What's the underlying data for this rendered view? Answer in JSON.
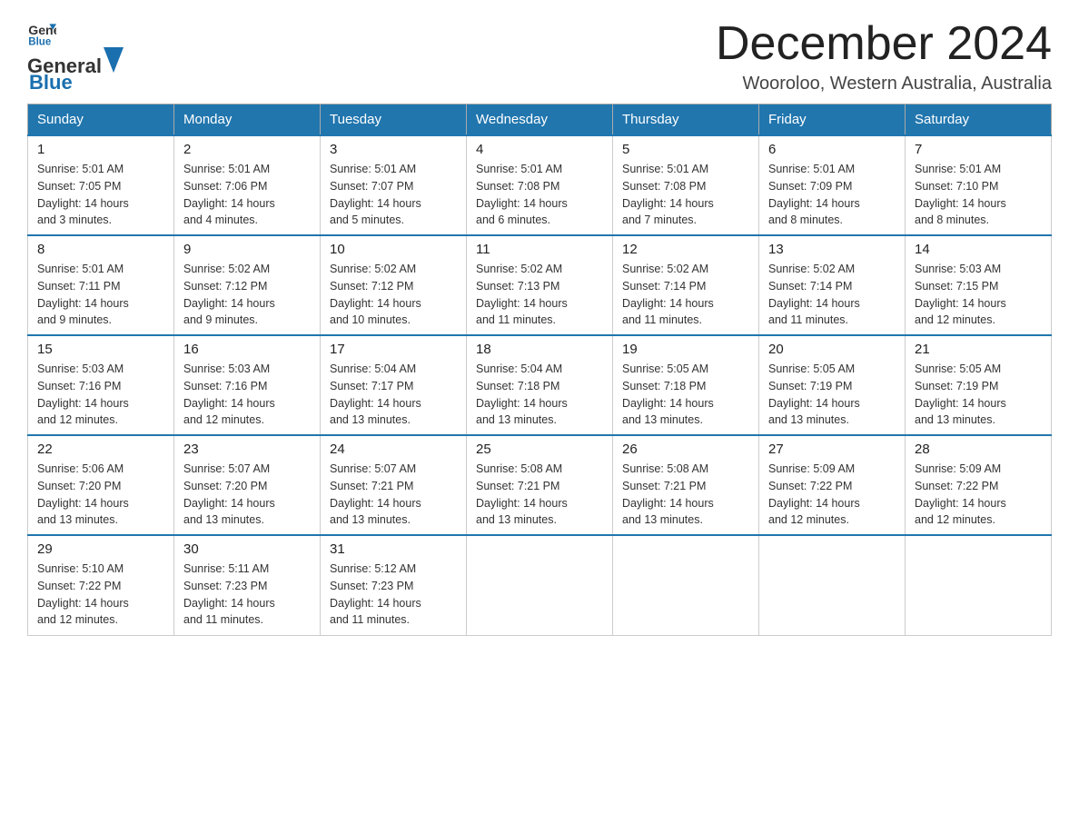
{
  "logo": {
    "general": "General",
    "blue": "Blue"
  },
  "title": "December 2024",
  "location": "Wooroloo, Western Australia, Australia",
  "days_of_week": [
    "Sunday",
    "Monday",
    "Tuesday",
    "Wednesday",
    "Thursday",
    "Friday",
    "Saturday"
  ],
  "weeks": [
    [
      {
        "day": "1",
        "sunrise": "5:01 AM",
        "sunset": "7:05 PM",
        "daylight": "14 hours and 3 minutes."
      },
      {
        "day": "2",
        "sunrise": "5:01 AM",
        "sunset": "7:06 PM",
        "daylight": "14 hours and 4 minutes."
      },
      {
        "day": "3",
        "sunrise": "5:01 AM",
        "sunset": "7:07 PM",
        "daylight": "14 hours and 5 minutes."
      },
      {
        "day": "4",
        "sunrise": "5:01 AM",
        "sunset": "7:08 PM",
        "daylight": "14 hours and 6 minutes."
      },
      {
        "day": "5",
        "sunrise": "5:01 AM",
        "sunset": "7:08 PM",
        "daylight": "14 hours and 7 minutes."
      },
      {
        "day": "6",
        "sunrise": "5:01 AM",
        "sunset": "7:09 PM",
        "daylight": "14 hours and 8 minutes."
      },
      {
        "day": "7",
        "sunrise": "5:01 AM",
        "sunset": "7:10 PM",
        "daylight": "14 hours and 8 minutes."
      }
    ],
    [
      {
        "day": "8",
        "sunrise": "5:01 AM",
        "sunset": "7:11 PM",
        "daylight": "14 hours and 9 minutes."
      },
      {
        "day": "9",
        "sunrise": "5:02 AM",
        "sunset": "7:12 PM",
        "daylight": "14 hours and 9 minutes."
      },
      {
        "day": "10",
        "sunrise": "5:02 AM",
        "sunset": "7:12 PM",
        "daylight": "14 hours and 10 minutes."
      },
      {
        "day": "11",
        "sunrise": "5:02 AM",
        "sunset": "7:13 PM",
        "daylight": "14 hours and 11 minutes."
      },
      {
        "day": "12",
        "sunrise": "5:02 AM",
        "sunset": "7:14 PM",
        "daylight": "14 hours and 11 minutes."
      },
      {
        "day": "13",
        "sunrise": "5:02 AM",
        "sunset": "7:14 PM",
        "daylight": "14 hours and 11 minutes."
      },
      {
        "day": "14",
        "sunrise": "5:03 AM",
        "sunset": "7:15 PM",
        "daylight": "14 hours and 12 minutes."
      }
    ],
    [
      {
        "day": "15",
        "sunrise": "5:03 AM",
        "sunset": "7:16 PM",
        "daylight": "14 hours and 12 minutes."
      },
      {
        "day": "16",
        "sunrise": "5:03 AM",
        "sunset": "7:16 PM",
        "daylight": "14 hours and 12 minutes."
      },
      {
        "day": "17",
        "sunrise": "5:04 AM",
        "sunset": "7:17 PM",
        "daylight": "14 hours and 13 minutes."
      },
      {
        "day": "18",
        "sunrise": "5:04 AM",
        "sunset": "7:18 PM",
        "daylight": "14 hours and 13 minutes."
      },
      {
        "day": "19",
        "sunrise": "5:05 AM",
        "sunset": "7:18 PM",
        "daylight": "14 hours and 13 minutes."
      },
      {
        "day": "20",
        "sunrise": "5:05 AM",
        "sunset": "7:19 PM",
        "daylight": "14 hours and 13 minutes."
      },
      {
        "day": "21",
        "sunrise": "5:05 AM",
        "sunset": "7:19 PM",
        "daylight": "14 hours and 13 minutes."
      }
    ],
    [
      {
        "day": "22",
        "sunrise": "5:06 AM",
        "sunset": "7:20 PM",
        "daylight": "14 hours and 13 minutes."
      },
      {
        "day": "23",
        "sunrise": "5:07 AM",
        "sunset": "7:20 PM",
        "daylight": "14 hours and 13 minutes."
      },
      {
        "day": "24",
        "sunrise": "5:07 AM",
        "sunset": "7:21 PM",
        "daylight": "14 hours and 13 minutes."
      },
      {
        "day": "25",
        "sunrise": "5:08 AM",
        "sunset": "7:21 PM",
        "daylight": "14 hours and 13 minutes."
      },
      {
        "day": "26",
        "sunrise": "5:08 AM",
        "sunset": "7:21 PM",
        "daylight": "14 hours and 13 minutes."
      },
      {
        "day": "27",
        "sunrise": "5:09 AM",
        "sunset": "7:22 PM",
        "daylight": "14 hours and 12 minutes."
      },
      {
        "day": "28",
        "sunrise": "5:09 AM",
        "sunset": "7:22 PM",
        "daylight": "14 hours and 12 minutes."
      }
    ],
    [
      {
        "day": "29",
        "sunrise": "5:10 AM",
        "sunset": "7:22 PM",
        "daylight": "14 hours and 12 minutes."
      },
      {
        "day": "30",
        "sunrise": "5:11 AM",
        "sunset": "7:23 PM",
        "daylight": "14 hours and 11 minutes."
      },
      {
        "day": "31",
        "sunrise": "5:12 AM",
        "sunset": "7:23 PM",
        "daylight": "14 hours and 11 minutes."
      },
      null,
      null,
      null,
      null
    ]
  ],
  "labels": {
    "sunrise": "Sunrise:",
    "sunset": "Sunset:",
    "daylight": "Daylight:"
  }
}
